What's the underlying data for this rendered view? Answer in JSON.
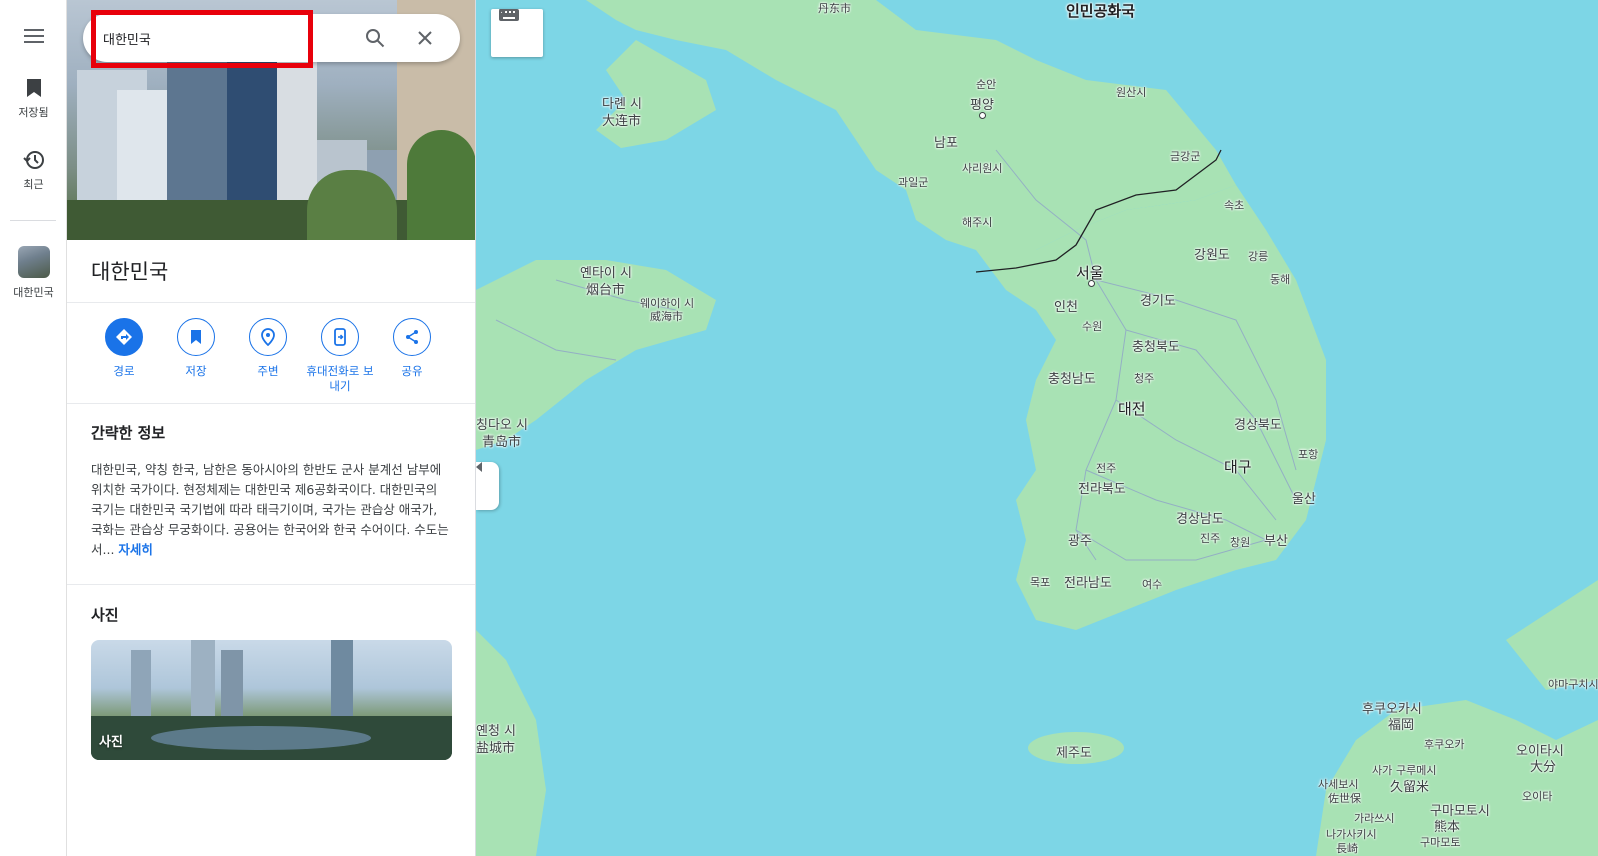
{
  "rail": {
    "saved_label": "저장됨",
    "recent_label": "최근",
    "current_place_label": "대한민국"
  },
  "search": {
    "value": "대한민국"
  },
  "place": {
    "title": "대한민국",
    "actions": [
      {
        "label": "경로"
      },
      {
        "label": "저장"
      },
      {
        "label": "주변"
      },
      {
        "label": "휴대전화로 보내기"
      },
      {
        "label": "공유"
      }
    ]
  },
  "overview": {
    "heading": "간략한 정보",
    "text": "대한민국, 약칭 한국, 남한은 동아시아의 한반도 군사 분계선 남부에 위치한 국가이다. 현정체제는 대한민국 제6공화국이다. 대한민국의 국기는 대한민국 국기법에 따라 태극기이며, 국가는 관습상 애국가, 국화는 관습상 무궁화이다. 공용어는 한국어와 한국 수어이다. 수도는 서...",
    "more_label": "자세히"
  },
  "photos": {
    "heading": "사진",
    "card_label": "사진"
  },
  "map": {
    "labels": {
      "dandong": "丹东市",
      "dprk": "인민공화국",
      "dalian_ko": "다롄 시",
      "dalian_zh": "大连市",
      "yantai_ko": "옌타이 시",
      "yantai_zh": "烟台市",
      "weihai_ko": "웨이하이 시",
      "weihai_zh": "威海市",
      "qingdao_ko": "칭다오 시",
      "qingdao_zh": "青岛市",
      "yancheng_ko": "옌청 시",
      "yancheng_zh": "盐城市",
      "pyongyang": "평양",
      "sunan": "순안",
      "nampo": "남포",
      "sariwon": "사리원시",
      "gwail": "과일군",
      "haeju": "해주시",
      "wonsan": "원산시",
      "geumgang": "금강군",
      "sokcho": "속초",
      "seoul": "서울",
      "incheon": "인천",
      "suwon": "수원",
      "gyeonggi": "경기도",
      "gangwon": "강원도",
      "gangneung": "강릉",
      "donghae": "동해",
      "chungbuk": "충청북도",
      "chungnam": "충청남도",
      "cheongju": "청주",
      "daejeon": "대전",
      "gyeongbuk": "경상북도",
      "pohang": "포항",
      "daegu": "대구",
      "ulsan": "울산",
      "jeonju": "전주",
      "jeonbuk": "전라북도",
      "gwangju": "광주",
      "gyeongnam": "경상남도",
      "jinju": "진주",
      "changwon": "창원",
      "busan": "부산",
      "mokpo": "목포",
      "jeonnam": "전라남도",
      "yeosu": "여수",
      "jeju": "제주도",
      "fukuoka_ko": "후쿠오카시",
      "fukuoka_zh": "福岡",
      "kurume_ko": "구루메시",
      "kurume_zh": "久留米",
      "sasebo_ko": "사세보시",
      "sasebo_zh": "佐世保",
      "nagasaki_ko": "나가사키시",
      "nagasaki_zh": "長崎",
      "kumamoto_ko": "구마모토시",
      "kumamoto_zh": "熊本",
      "oita_ko": "오이타시",
      "oita_zh": "大分",
      "yamaguchi": "야마구치시",
      "hisa": "후쿠오카",
      "saga": "사가",
      "karatsu": "가라쓰시",
      "oitashi": "오이타",
      "kumamoto2": "구마모토"
    }
  },
  "colors": {
    "accent": "#1a73e8",
    "water": "#7dd6e6",
    "land": "#a8e2b4",
    "highlight": "#e8000b"
  }
}
